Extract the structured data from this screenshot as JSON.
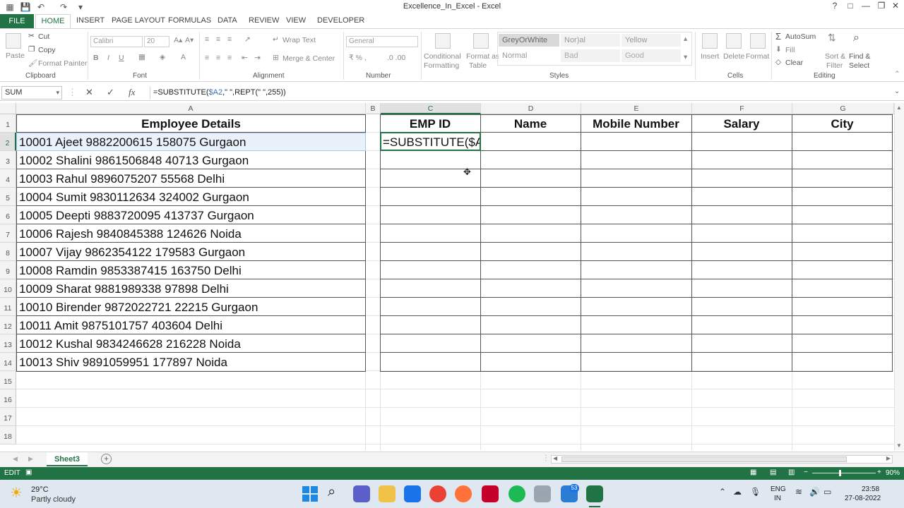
{
  "window": {
    "title": "Excellence_In_Excel - Excel"
  },
  "window_controls": [
    "?",
    "□",
    "—",
    "❐",
    "✕"
  ],
  "ribbon_tabs": [
    "FILE",
    "HOME",
    "INSERT",
    "PAGE LAYOUT",
    "FORMULAS",
    "DATA",
    "REVIEW",
    "VIEW",
    "DEVELOPER"
  ],
  "clipboard": {
    "paste": "Paste",
    "cut": "Cut",
    "copy": "Copy",
    "format_painter": "Format Painter",
    "label": "Clipboard"
  },
  "font": {
    "name": "Calibri",
    "size": "20",
    "bold": "B",
    "italic": "I",
    "underline": "U",
    "label": "Font"
  },
  "alignment": {
    "wrap": "Wrap Text",
    "merge": "Merge & Center",
    "label": "Alignment"
  },
  "number": {
    "format": "General",
    "label": "Number"
  },
  "styles": {
    "conditional": [
      "Conditional",
      "Formatting"
    ],
    "format_as_table": [
      "Format as",
      "Table"
    ],
    "cells": [
      "GreyOrWhite",
      "Nor)al",
      "Yellow",
      "Normal",
      "Bad",
      "Good"
    ],
    "label": "Styles"
  },
  "cells_group": {
    "insert": "Insert",
    "delete": "Delete",
    "format": "Format",
    "label": "Cells"
  },
  "editing": {
    "autosum": "AutoSum",
    "fill": "Fill",
    "clear": "Clear",
    "sort": [
      "Sort &",
      "Filter"
    ],
    "find": [
      "Find &",
      "Select"
    ],
    "label": "Editing"
  },
  "formula_bar": {
    "name_box": "SUM",
    "fx": "fx",
    "formula_start": "=SUBSTITUTE(",
    "formula_ref": "$A2",
    "formula_end": ",\" \",REPT(\" \",255))"
  },
  "columns": [
    "A",
    "B",
    "C",
    "D",
    "E",
    "F",
    "G"
  ],
  "rows": [
    "1",
    "2",
    "3",
    "4",
    "5",
    "6",
    "7",
    "8",
    "9",
    "10",
    "11",
    "12",
    "13",
    "14",
    "15",
    "16",
    "17",
    "18"
  ],
  "headers": {
    "employee_details": "Employee Details",
    "emp_id": "EMP ID",
    "name": "Name",
    "mobile": "Mobile Number",
    "salary": "Salary",
    "city": "City"
  },
  "employees": [
    "10001 Ajeet 9882200615 158075 Gurgaon",
    "10002 Shalini 9861506848 40713 Gurgaon",
    "10003 Rahul 9896075207 55568 Delhi",
    "10004 Sumit 9830112634 324002 Gurgaon",
    "10005 Deepti 9883720095 413737 Gurgaon",
    "10006 Rajesh 9840845388 124626 Noida",
    "10007 Vijay 9862354122 179583 Gurgaon",
    "10008 Ramdin 9853387415 163750 Delhi",
    "10009 Sharat 9881989338 97898 Delhi",
    "10010 Birender 9872022721 22215 Gurgaon",
    "10011 Amit 9875101757 403604 Delhi",
    "10012 Kushal 9834246628 216228 Noida",
    "10013 Shiv 9891059951 177897 Noida"
  ],
  "editing_cell": "=SUBSTITUTE($A",
  "sheet_tab": "Sheet3",
  "status": {
    "mode": "EDIT",
    "zoom": "90%"
  },
  "taskbar": {
    "weather_temp": "29°C",
    "weather_desc": "Partly cloudy",
    "lang1": "ENG",
    "lang2": "IN",
    "time": "23:58",
    "date": "27-08-2022",
    "badge": "53"
  }
}
